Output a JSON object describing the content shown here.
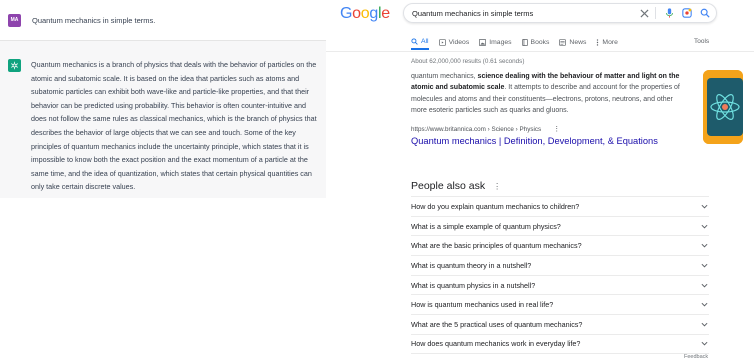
{
  "chat": {
    "user_avatar": "MA",
    "user_message": "Quantum mechanics in simple terms.",
    "bot_message": "Quantum mechanics is a branch of physics that deals with the behavior of particles on the atomic and subatomic scale. It is based on the idea that particles such as atoms and subatomic particles can exhibit both wave-like and particle-like properties, and that their behavior can be predicted using probability. This behavior is often counter-intuitive and does not follow the same rules as classical mechanics, which is the branch of physics that describes the behavior of large objects that we can see and touch. Some of the key principles of quantum mechanics include the uncertainty principle, which states that it is impossible to know both the exact position and the exact momentum of a particle at the same time, and the idea of quantization, which states that certain physical quantities can only take certain discrete values.",
    "colors": {
      "user_avatar": "#8e44ad",
      "bot_avatar": "#10a37f",
      "bot_bg": "#f7f7f8"
    }
  },
  "google": {
    "logo": {
      "letters": [
        "G",
        "o",
        "o",
        "g",
        "l",
        "e"
      ],
      "colors": [
        "#4285f4",
        "#ea4335",
        "#fbbc05",
        "#4285f4",
        "#34a853",
        "#ea4335"
      ]
    },
    "search_query": "Quantum mechanics in simple terms",
    "icons": [
      "close-icon",
      "mic-icon",
      "lens-icon",
      "search-icon"
    ],
    "tabs": [
      {
        "label": "All",
        "icon": "search-icon"
      },
      {
        "label": "Videos",
        "icon": "video-icon"
      },
      {
        "label": "Images",
        "icon": "image-icon"
      },
      {
        "label": "Books",
        "icon": "book-icon"
      },
      {
        "label": "News",
        "icon": "news-icon"
      },
      {
        "label": "More",
        "icon": "more-icon"
      }
    ],
    "tools_label": "Tools",
    "stats": "About 62,000,000 results (0.61 seconds)",
    "snippet": {
      "part1": "quantum mechanics, ",
      "bold": "science dealing with the behaviour of matter and light on the atomic and subatomic scale",
      "part2": ". It attempts to describe and account for the properties of molecules and atoms and their constituents—electrons, protons, neutrons, and other more esoteric particles such as quarks and gluons."
    },
    "result_url": "https://www.britannica.com › Science › Physics",
    "result_title": "Quantum mechanics | Definition, Development, & Equations",
    "paa_title": "People also ask",
    "paa_questions": [
      "How do you explain quantum mechanics to children?",
      "What is a simple example of quantum physics?",
      "What are the basic principles of quantum mechanics?",
      "What is quantum theory in a nutshell?",
      "What is quantum physics in a nutshell?",
      "How is quantum mechanics used in real life?",
      "What are the 5 practical uses of quantum mechanics?",
      "How does quantum mechanics work in everyday life?"
    ],
    "feedback_label": "Feedback",
    "colors": {
      "link": "#1a0dab",
      "active_tab": "#1a73e8"
    }
  }
}
